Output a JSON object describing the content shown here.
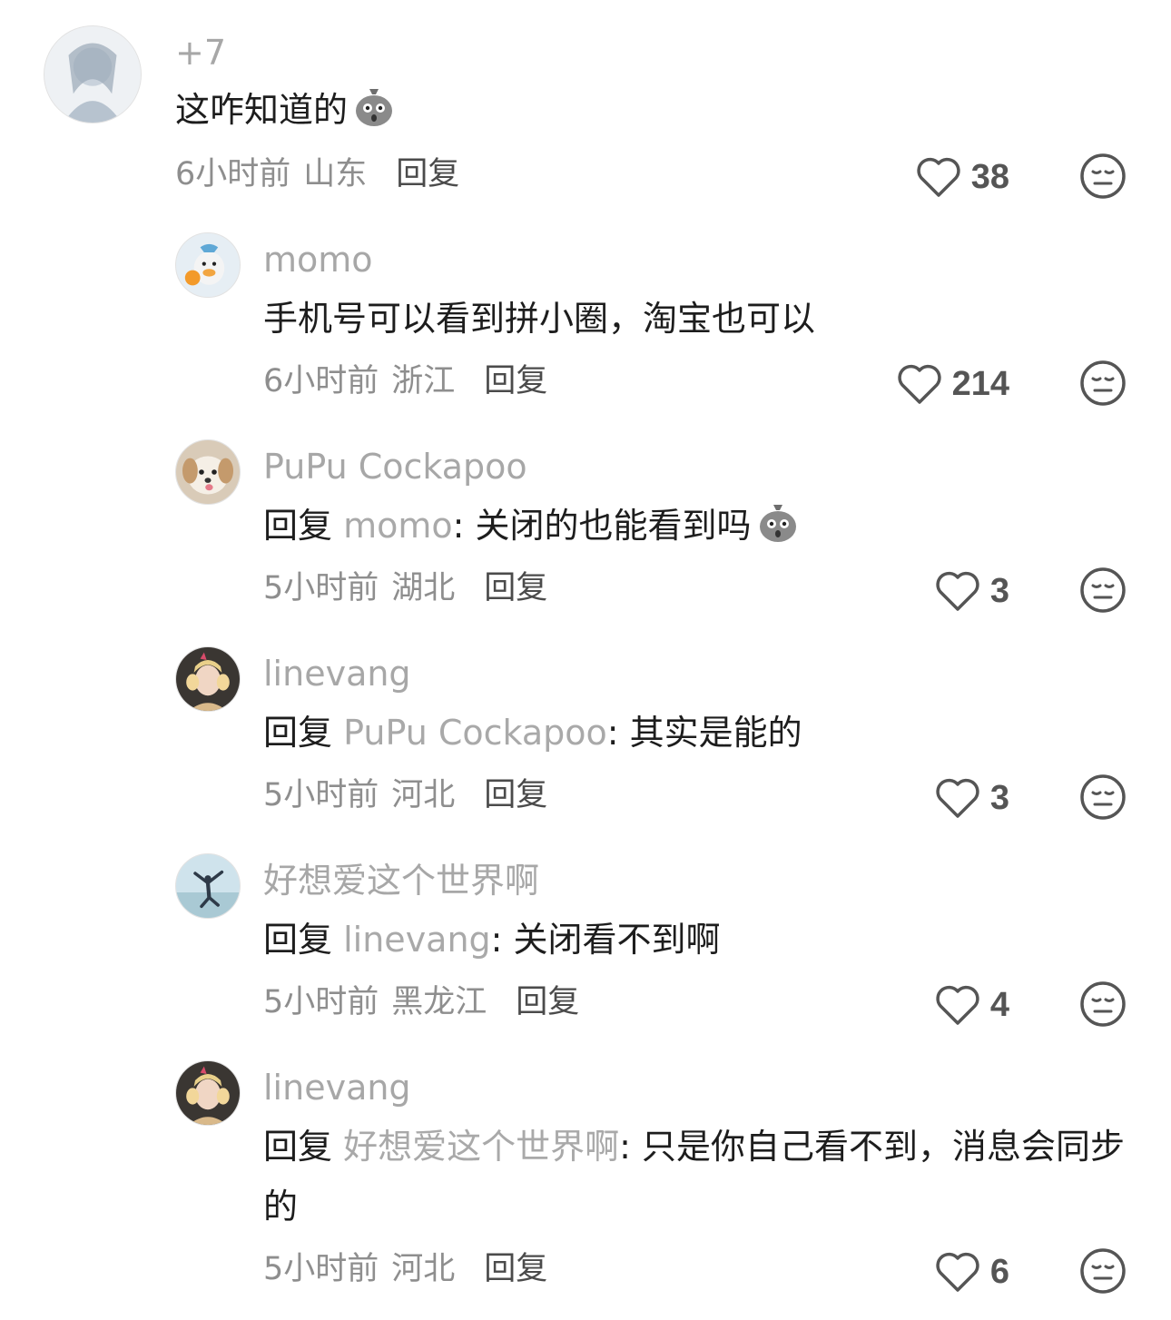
{
  "comments": [
    {
      "name": "+7",
      "text": "这咋知道的",
      "emoji": "shocked-bag-emoji",
      "time": "6小时前",
      "location": "山东",
      "reply_label": "回复",
      "likes": "38"
    },
    {
      "name": "momo",
      "text": "手机号可以看到拼小圈，淘宝也可以",
      "time": "6小时前",
      "location": "浙江",
      "reply_label": "回复",
      "likes": "214"
    },
    {
      "name": "PuPu Cockapoo",
      "reply_word": "回复",
      "mention": "momo",
      "text": ": 关闭的也能看到吗",
      "emoji": "shocked-bag-emoji",
      "time": "5小时前",
      "location": "湖北",
      "reply_label": "回复",
      "likes": "3"
    },
    {
      "name": "linevang",
      "reply_word": "回复",
      "mention": "PuPu Cockapoo",
      "text": ": 其实是能的",
      "time": "5小时前",
      "location": "河北",
      "reply_label": "回复",
      "likes": "3"
    },
    {
      "name": "好想爱这个世界啊",
      "reply_word": "回复",
      "mention": "linevang",
      "text": ": 关闭看不到啊",
      "time": "5小时前",
      "location": "黑龙江",
      "reply_label": "回复",
      "likes": "4"
    },
    {
      "name": "linevang",
      "reply_word": "回复",
      "mention": "好想爱这个世界啊",
      "text": ": 只是你自己看不到，消息会同步的",
      "time": "5小时前",
      "location": "河北",
      "reply_label": "回复",
      "likes": "6"
    }
  ],
  "icons": {
    "like": "heart-outline-icon",
    "dislike": "meh-face-icon"
  },
  "colors": {
    "name": "#a7a7a7",
    "text": "#1d1d1d",
    "meta": "#8e8e8e",
    "icon": "#555555"
  }
}
